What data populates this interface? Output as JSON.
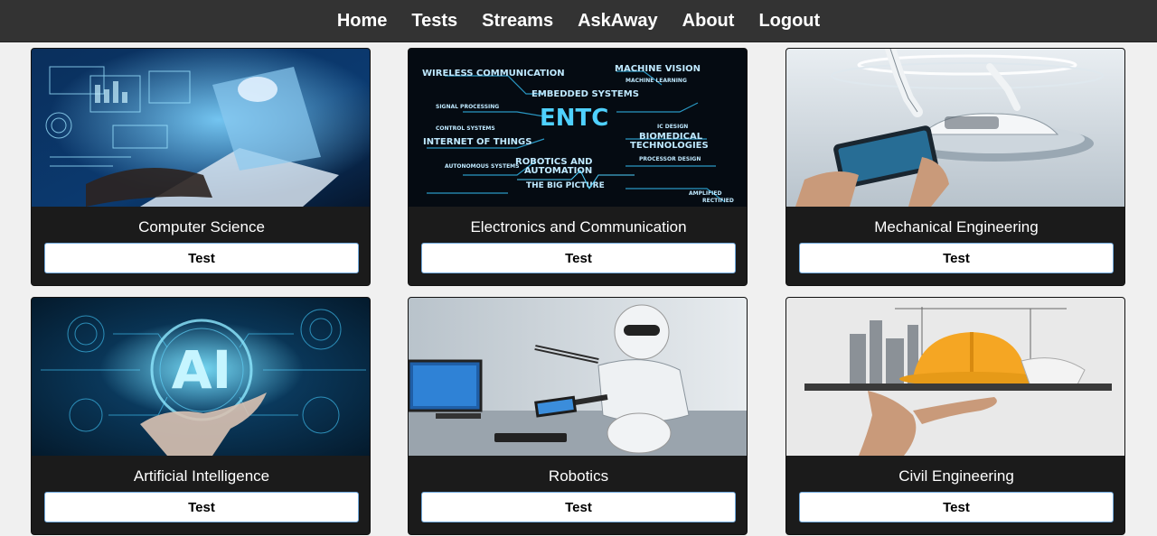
{
  "nav": {
    "items": [
      {
        "label": "Home"
      },
      {
        "label": "Tests"
      },
      {
        "label": "Streams"
      },
      {
        "label": "AskAway"
      },
      {
        "label": "About"
      },
      {
        "label": "Logout"
      }
    ]
  },
  "cards": [
    {
      "title": "Computer Science",
      "button": "Test",
      "image": "laptop-hologram-image"
    },
    {
      "title": "Electronics and Communication",
      "button": "Test",
      "image": "entc-circuit-image",
      "image_text": {
        "main": "ENTC",
        "labels": [
          "WIRELESS COMMUNICATION",
          "MACHINE VISION",
          "MACHINE LEARNING",
          "EMBEDDED SYSTEMS",
          "SIGNAL PROCESSING",
          "CONTROL SYSTEMS",
          "INTERNET OF THINGS",
          "IC DESIGN",
          "BIOMEDICAL",
          "TECHNOLOGIES",
          "PROCESSOR DESIGN",
          "AUTONOMOUS SYSTEMS",
          "ROBOTICS AND",
          "AUTOMATION",
          "THE BIG PICTURE",
          "AMPLIFIED",
          "RECTIFIED"
        ]
      }
    },
    {
      "title": "Mechanical Engineering",
      "button": "Test",
      "image": "robot-arm-tablet-image"
    },
    {
      "title": "Artificial Intelligence",
      "button": "Test",
      "image": "ai-hologram-hand-image",
      "image_text": {
        "main": "AI"
      }
    },
    {
      "title": "Robotics",
      "button": "Test",
      "image": "humanoid-robot-image"
    },
    {
      "title": "Civil Engineering",
      "button": "Test",
      "image": "hardhat-city-image"
    }
  ],
  "colors": {
    "navbar": "#333333",
    "page_bg": "#f0f0f0",
    "card_bg": "#1b1b1b",
    "button_border": "#6fa8dc",
    "hardhat": "#f5a623"
  }
}
